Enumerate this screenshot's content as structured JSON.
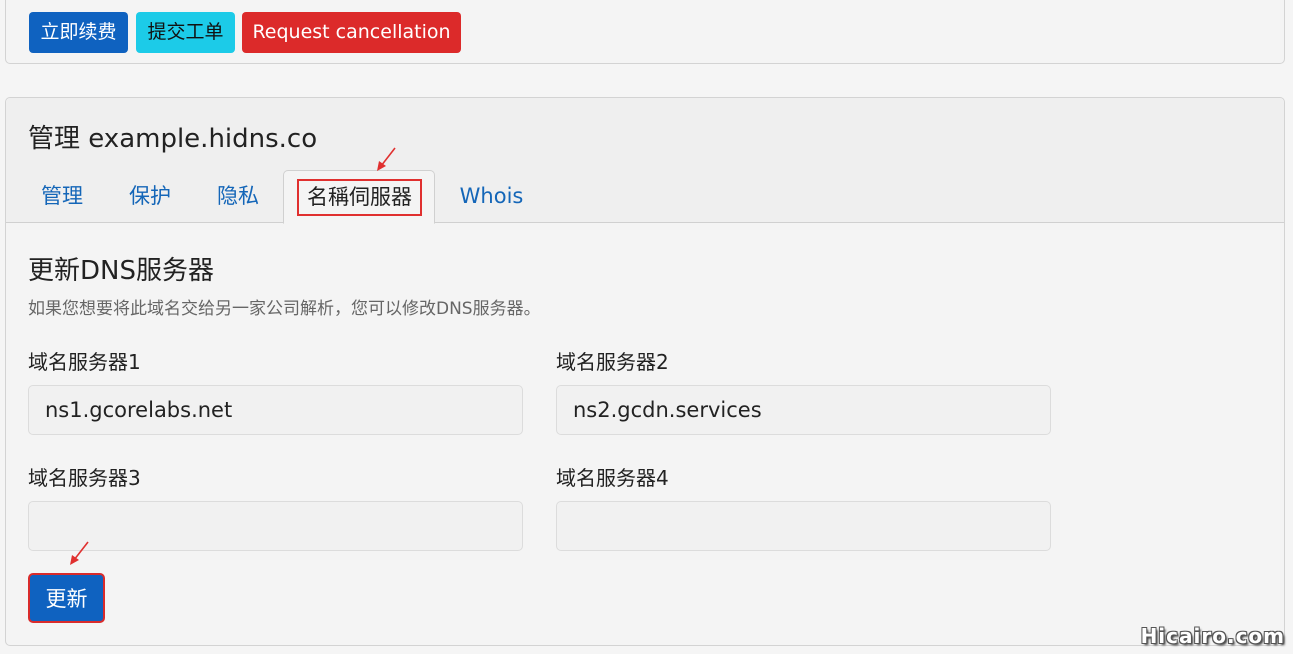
{
  "top_actions": {
    "renew_label": "立即续费",
    "ticket_label": "提交工单",
    "cancel_label": "Request cancellation"
  },
  "manage": {
    "title": "管理 example.hidns.co",
    "tabs": [
      {
        "label": "管理"
      },
      {
        "label": "保护"
      },
      {
        "label": "隐私"
      },
      {
        "label": "名稱伺服器"
      },
      {
        "label": "Whois"
      }
    ],
    "active_tab": "名稱伺服器"
  },
  "dns_form": {
    "title": "更新DNS服务器",
    "description": "如果您想要将此域名交给另一家公司解析，您可以修改DNS服务器。",
    "fields": [
      {
        "label": "域名服务器1",
        "value": "ns1.gcorelabs.net"
      },
      {
        "label": "域名服务器2",
        "value": "ns2.gcdn.services"
      },
      {
        "label": "域名服务器3",
        "value": ""
      },
      {
        "label": "域名服务器4",
        "value": ""
      }
    ],
    "submit_label": "更新"
  },
  "watermark": "Hicairo.com",
  "colors": {
    "primary": "#0f62c0",
    "info": "#1ccbe8",
    "danger": "#dc2a2a",
    "highlight": "#e0302f",
    "link": "#1466b8"
  }
}
